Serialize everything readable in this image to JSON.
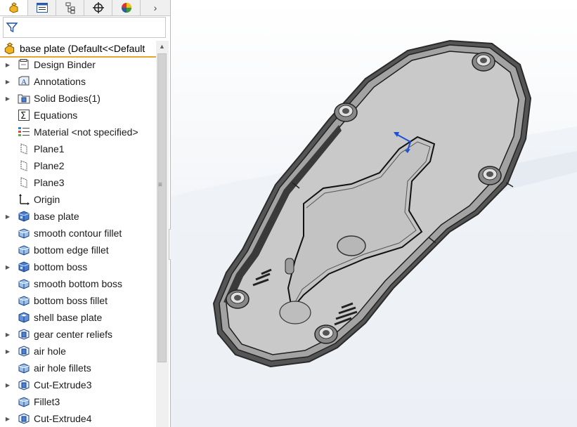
{
  "tree_root": {
    "label": "base plate  (Default<<Default"
  },
  "tree_items": [
    {
      "label": "Design Binder",
      "icon": "design-binder-icon",
      "expandable": true
    },
    {
      "label": "Annotations",
      "icon": "annotations-icon",
      "expandable": true
    },
    {
      "label": "Solid Bodies(1)",
      "icon": "solid-bodies-folder-icon",
      "expandable": true
    },
    {
      "label": "Equations",
      "icon": "equations-icon",
      "expandable": false
    },
    {
      "label": "Material <not specified>",
      "icon": "material-icon",
      "expandable": false
    },
    {
      "label": "Plane1",
      "icon": "plane-icon",
      "expandable": false
    },
    {
      "label": "Plane2",
      "icon": "plane-icon",
      "expandable": false
    },
    {
      "label": "Plane3",
      "icon": "plane-icon",
      "expandable": false
    },
    {
      "label": "Origin",
      "icon": "origin-icon",
      "expandable": false
    },
    {
      "label": "base plate",
      "icon": "boss-extrude-icon",
      "expandable": true
    },
    {
      "label": "smooth contour fillet",
      "icon": "fillet-icon",
      "expandable": false
    },
    {
      "label": "bottom edge fillet",
      "icon": "fillet-icon",
      "expandable": false
    },
    {
      "label": "bottom boss",
      "icon": "boss-extrude-icon",
      "expandable": true
    },
    {
      "label": "smooth bottom boss",
      "icon": "fillet-icon",
      "expandable": false
    },
    {
      "label": "bottom boss fillet",
      "icon": "fillet-icon",
      "expandable": false
    },
    {
      "label": "shell base plate",
      "icon": "shell-icon",
      "expandable": false
    },
    {
      "label": "gear center reliefs",
      "icon": "cut-extrude-icon",
      "expandable": true
    },
    {
      "label": "air hole",
      "icon": "cut-extrude-icon",
      "expandable": true
    },
    {
      "label": "air hole fillets",
      "icon": "fillet-icon",
      "expandable": false
    },
    {
      "label": "Cut-Extrude3",
      "icon": "cut-extrude-icon",
      "expandable": true
    },
    {
      "label": "Fillet3",
      "icon": "fillet-icon",
      "expandable": false
    },
    {
      "label": "Cut-Extrude4",
      "icon": "cut-extrude-icon",
      "expandable": true
    }
  ],
  "tabs": [
    "feature-manager-tab",
    "property-manager-tab",
    "configuration-manager-tab",
    "dimxpert-tab",
    "display-manager-tab"
  ],
  "colors": {
    "accent": "#e3a72f",
    "part_gray": "#c8c8c8",
    "triad_blue": "#1d4fd8"
  }
}
